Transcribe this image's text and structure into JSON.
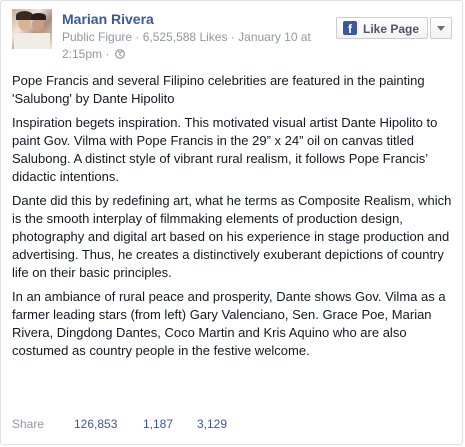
{
  "page": {
    "name": "Marian Rivera",
    "category": "Public Figure",
    "likes": "6,525,588 Likes",
    "date": "January 10 at",
    "time": "2:15pm",
    "separator": "·",
    "privacy_icon": "globe-icon"
  },
  "like_button": {
    "icon": "facebook-f-icon",
    "icon_glyph": "f",
    "label": "Like Page",
    "dropdown_icon": "chevron-down-icon"
  },
  "post": {
    "paragraphs": [
      "Pope Francis and several Filipino celebrities are featured in the painting 'Salubong' by Dante Hipolito",
      "Inspiration begets inspiration. This motivated visual artist Dante Hipolito to paint Gov. Vilma with Pope Francis in the 29” x 24” oil on canvas titled Salubong. A distinct style of vibrant rural realism, it follows Pope Francis’ didactic intentions.",
      "Dante did this by redefining art, what he terms as Composite Realism, which is the smooth interplay of filmmaking elements of production design, photography and digital art based on his experience in stage production and advertising. Thus, he creates a distinctively exuberant depictions of country life on their basic principles.",
      "In an ambiance of rural peace and prosperity, Dante shows Gov. Vilma as a farmer leading stars (from left) Gary Valenciano, Sen. Grace Poe, Marian Rivera, Dingdong Dantes, Coco Martin and Kris Aquino who are also costumed as country people in the festive welcome."
    ]
  },
  "footer": {
    "share_label": "Share",
    "separator": "·",
    "likes_count": "126,853",
    "comments_count": "1,187",
    "shares_count": "3,129"
  },
  "colors": {
    "link_blue": "#3b5998",
    "meta_gray": "#9197a3",
    "text": "#141823"
  }
}
